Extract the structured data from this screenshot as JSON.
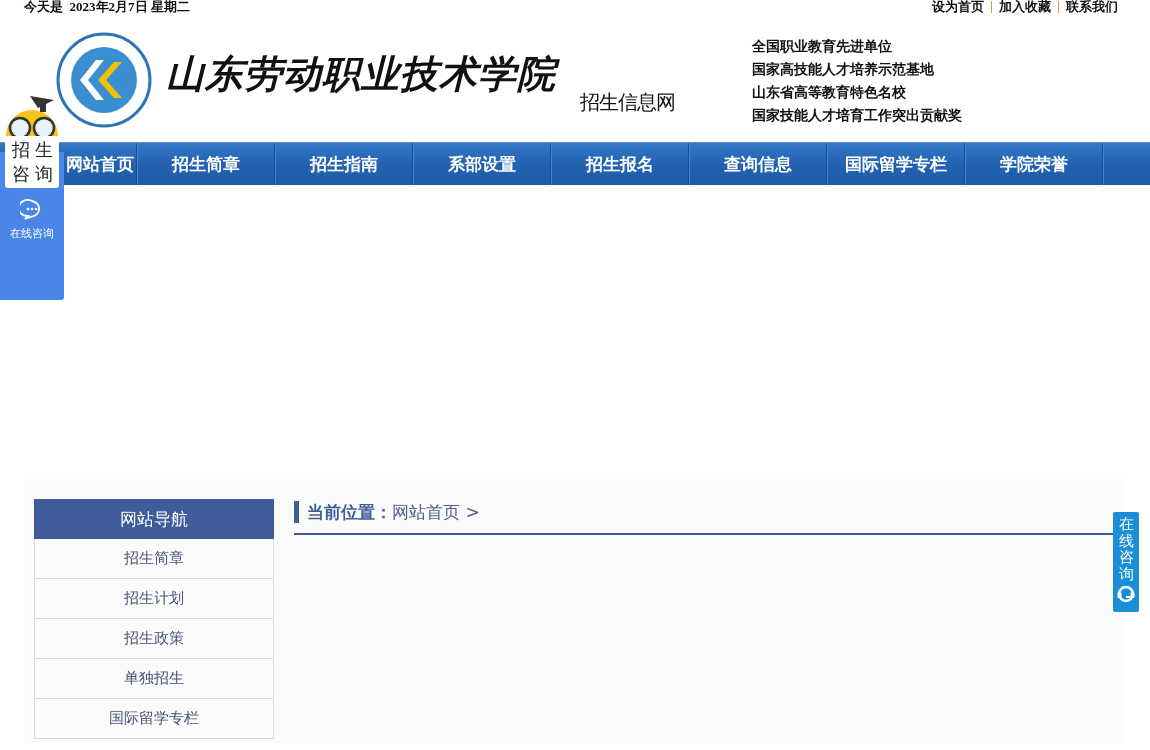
{
  "top_bar": {
    "date": "今天是  2023年2月7日 星期二",
    "links": [
      "设为首页",
      "加入收藏",
      "联系我们"
    ]
  },
  "header": {
    "college_name": "山东劳动职业技术学院",
    "site_name": "招生信息网",
    "honors": [
      "全国职业教育先进单位",
      "国家高技能人才培养示范基地",
      "山东省高等教育特色名校",
      "国家技能人才培育工作突出贡献奖"
    ]
  },
  "nav": [
    "网站首页",
    "招生简章",
    "招生指南",
    "系部设置",
    "招生报名",
    "查询信息",
    "国际留学专栏",
    "学院荣誉"
  ],
  "sidebar": {
    "title": "网站导航",
    "items": [
      "招生简章",
      "招生计划",
      "招生政策",
      "单独招生",
      "国际留学专栏"
    ]
  },
  "breadcrumb": {
    "label": "当前位置：",
    "path": "网站首页 >"
  },
  "left_widget": {
    "title_lines": [
      "招生",
      "咨询"
    ],
    "caption": "在线咨询"
  },
  "right_widget": {
    "label": "在线咨询"
  }
}
